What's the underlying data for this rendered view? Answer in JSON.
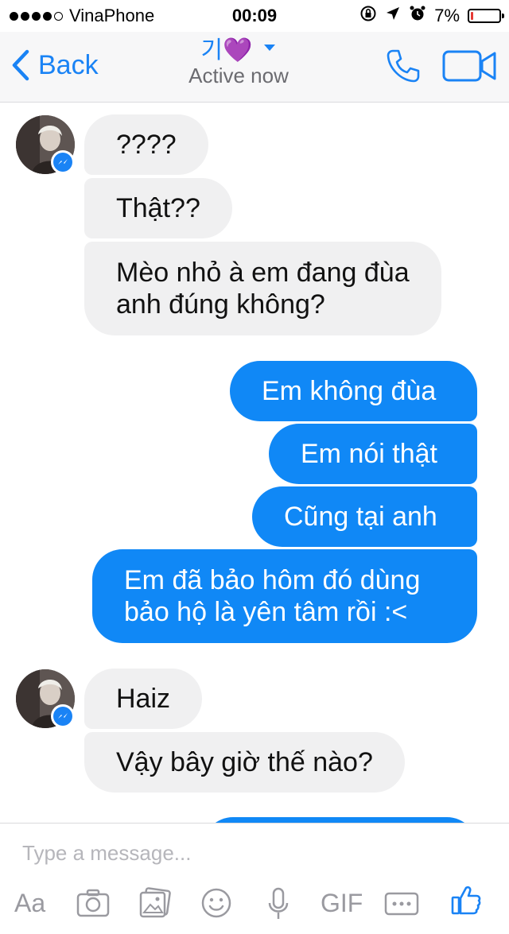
{
  "status": {
    "carrier": "VinaPhone",
    "time": "00:09",
    "battery": "7%",
    "battery_level": 0.07,
    "signal_bars": 4
  },
  "header": {
    "back_label": "Back",
    "contact_name": "기💜",
    "status": "Active now"
  },
  "messages": [
    {
      "from": "them",
      "text": "????"
    },
    {
      "from": "them",
      "text": "Thật??"
    },
    {
      "from": "them",
      "lines": [
        "Mèo nhỏ à em đang đùa",
        "anh đúng không?"
      ]
    },
    {
      "from": "me",
      "text": "Em không đùa"
    },
    {
      "from": "me",
      "text": "Em nói thật"
    },
    {
      "from": "me",
      "text": "Cũng tại anh"
    },
    {
      "from": "me",
      "lines": [
        "Em đã bảo hôm đó dùng",
        "bảo hộ là yên tâm rồi :<"
      ]
    },
    {
      "from": "them",
      "text": "Haiz"
    },
    {
      "from": "them",
      "text": "Vậy bây giờ thế nào?"
    }
  ],
  "composer": {
    "placeholder": "Type a message...",
    "tools": {
      "text": "Aa",
      "camera": "camera-icon",
      "gallery": "gallery-icon",
      "emoji": "emoji-icon",
      "mic": "microphone-icon",
      "gif": "GIF",
      "more": "more-icon",
      "like": "thumbs-up-icon"
    }
  },
  "colors": {
    "accent": "#1a83f5",
    "outgoing_bubble": "#1088f6",
    "incoming_bubble": "#f0f0f1",
    "battery_low": "#e53935"
  }
}
